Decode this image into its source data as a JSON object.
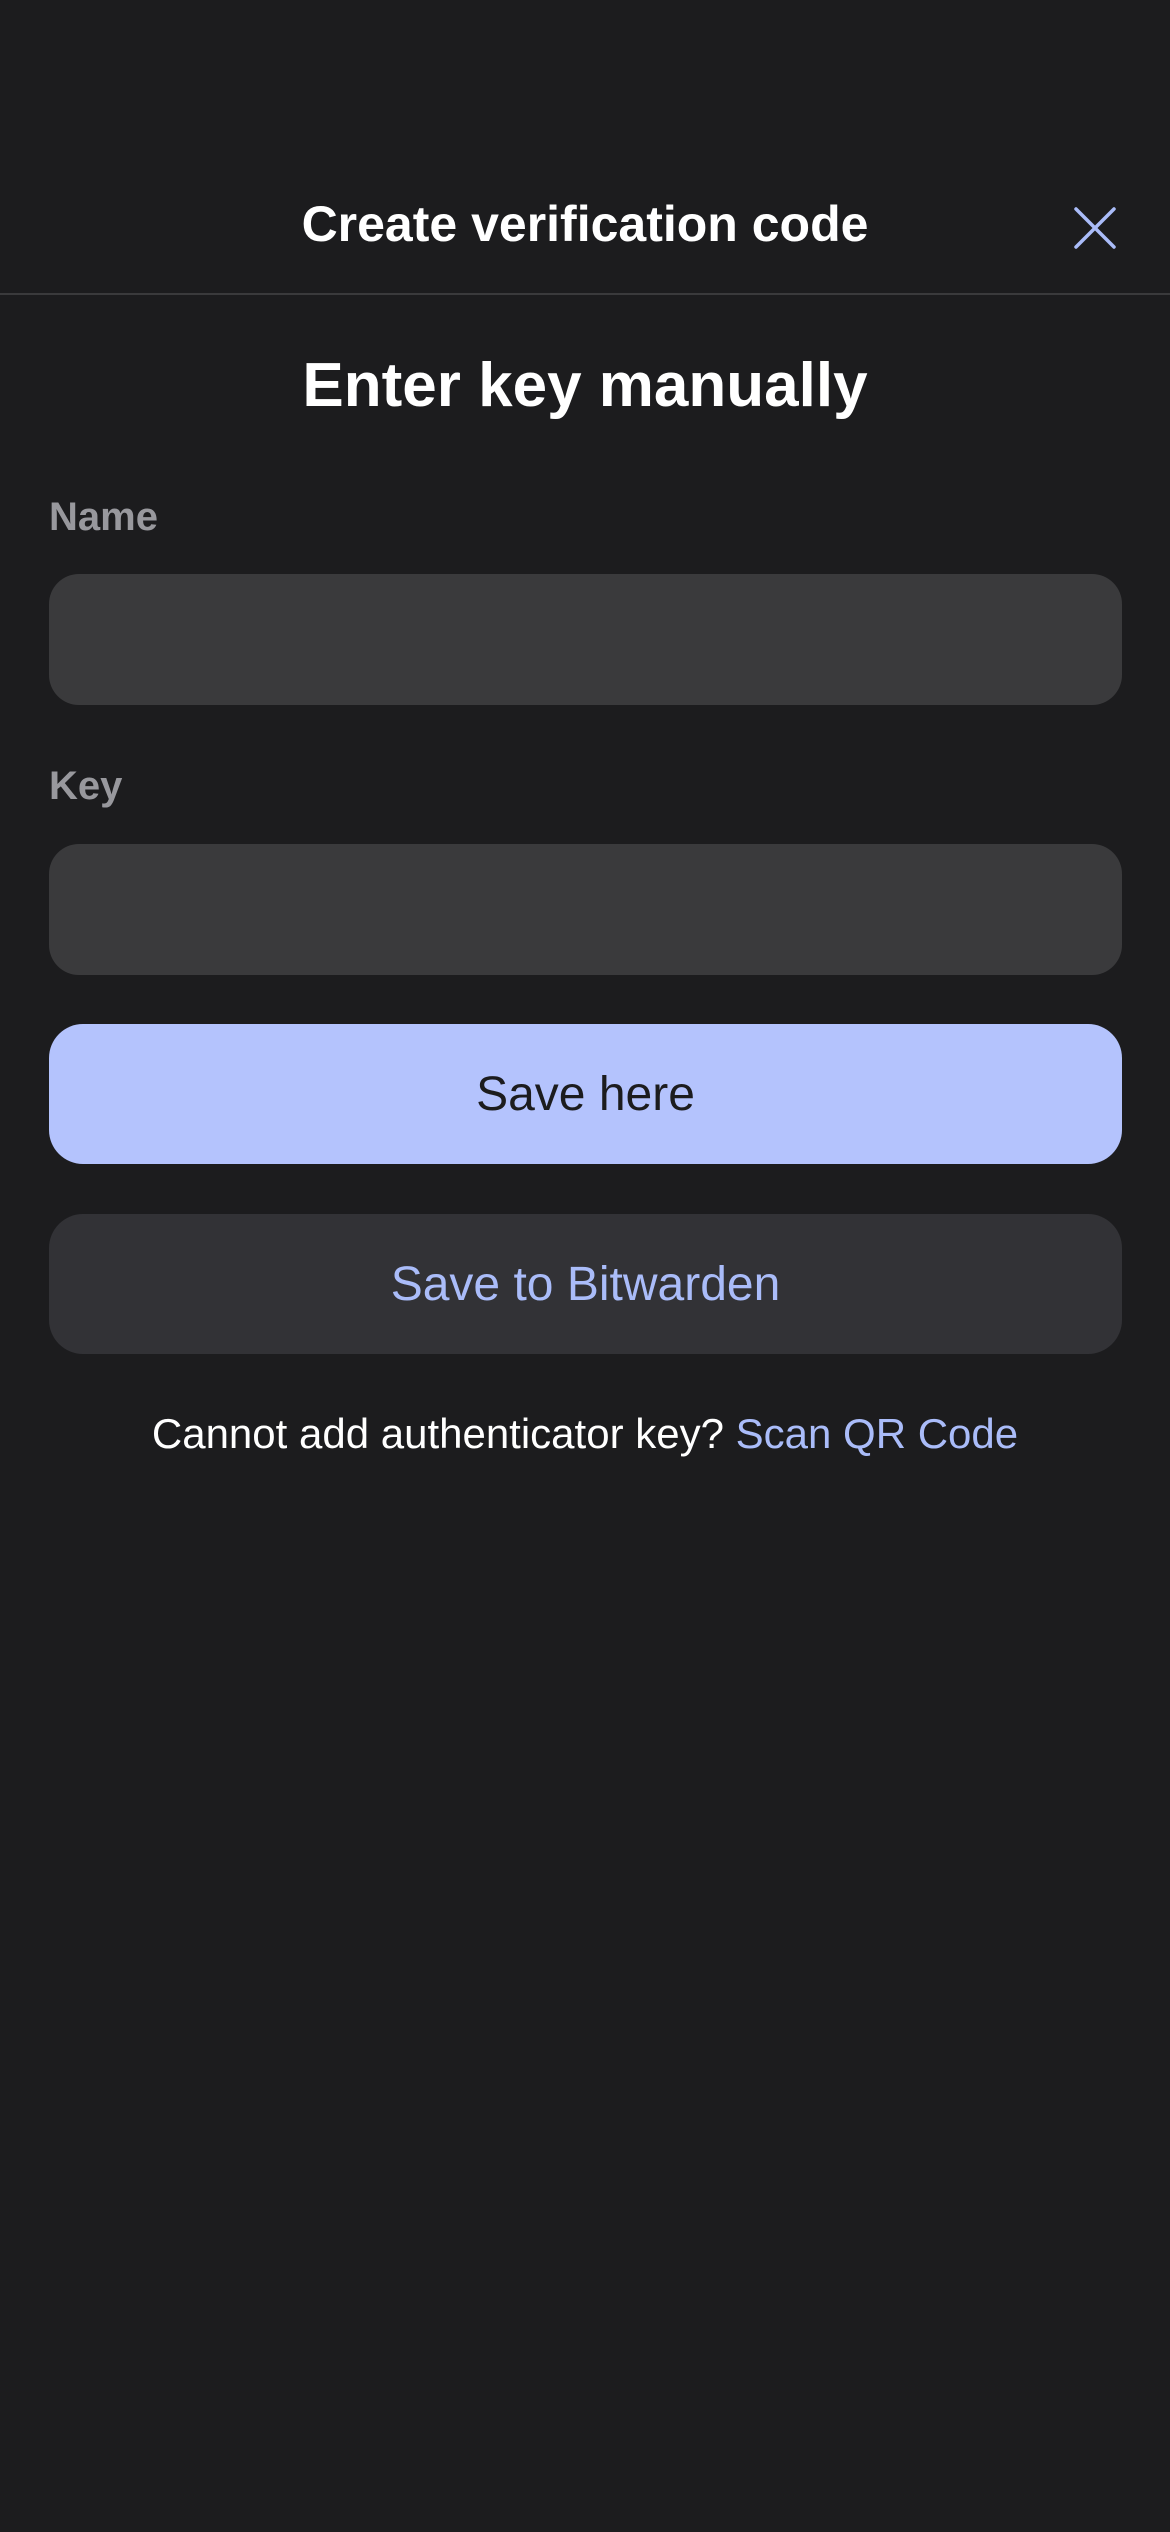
{
  "nav": {
    "title": "Create verification code",
    "close_icon": "close-icon"
  },
  "main": {
    "heading": "Enter key manually",
    "name_field": {
      "label": "Name",
      "value": "",
      "placeholder": ""
    },
    "key_field": {
      "label": "Key",
      "value": "",
      "placeholder": ""
    },
    "save_here_label": "Save here",
    "save_to_bitwarden_label": "Save to Bitwarden",
    "footer": {
      "prompt": "Cannot add authenticator key?",
      "link": "Scan QR Code"
    }
  },
  "colors": {
    "background": "#1c1c1e",
    "input_background": "#3a3a3c",
    "primary_button": "#b4c3fd",
    "secondary_button": "#323236",
    "accent": "#aabcf9",
    "label": "#98989d"
  }
}
